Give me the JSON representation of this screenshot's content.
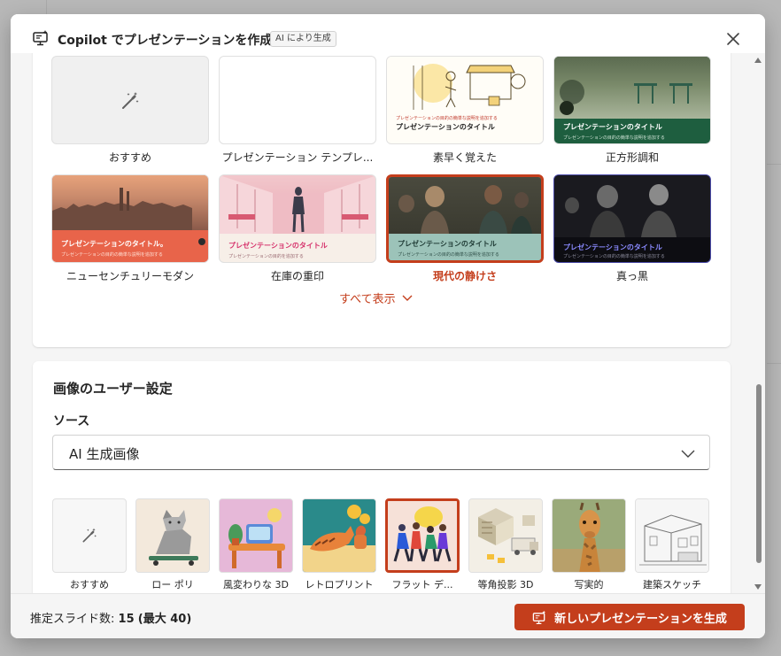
{
  "dialog": {
    "title": "Copilot でプレゼンテーションを作成",
    "ai_badge": "AI により生成"
  },
  "themes": {
    "items": [
      {
        "label": "おすすめ",
        "caption": "",
        "subcaption": ""
      },
      {
        "label": "プレゼンテーション テンプレ...",
        "caption": "",
        "subcaption": ""
      },
      {
        "label": "素早く覚えた",
        "caption": "プレゼンテーションのタイトル",
        "subcaption": "プレゼンテーションの目的の簡単な説明を追加する"
      },
      {
        "label": "正方形調和",
        "caption": "プレゼンテーションのタイトル",
        "subcaption": "プレゼンテーションの目的の簡単な説明を追加する"
      },
      {
        "label": "ニューセンチュリーモダン",
        "caption": "プレゼンテーションのタイトル。",
        "subcaption": "プレゼンテーションの目的の簡単な説明を追加する"
      },
      {
        "label": "在庫の重印",
        "caption": "プレゼンテーションのタイトル",
        "subcaption": "プレゼンテーションの目的を追加する"
      },
      {
        "label": "現代の静けさ",
        "caption": "プレゼンテーションのタイトル",
        "subcaption": "プレゼンテーションの目的の簡単な説明を追加する"
      },
      {
        "label": "真っ黒",
        "caption": "プレゼンテーションのタイトル",
        "subcaption": "プレゼンテーションの目的の簡単な説明を追加する"
      }
    ],
    "selected_index": 6,
    "show_all": "すべて表示"
  },
  "image_settings": {
    "title": "画像のユーザー設定",
    "source_label": "ソース",
    "source_value": "AI 生成画像",
    "styles": [
      {
        "label": "おすすめ"
      },
      {
        "label": "ロー ポリ"
      },
      {
        "label": "風変わりな 3D"
      },
      {
        "label": "レトロプリント"
      },
      {
        "label": "フラット デ..."
      },
      {
        "label": "等角投影 3D"
      },
      {
        "label": "写実的"
      },
      {
        "label": "建築スケッチ"
      }
    ],
    "selected_index": 4
  },
  "footer": {
    "slide_count_label": "推定スライド数:",
    "slide_count": "15",
    "max_label": "(最大 40)",
    "generate_label": "新しいプレゼンテーションを生成"
  },
  "colors": {
    "accent": "#c43e1c",
    "dialog_bg": "#f5f5f5",
    "card_bg": "#ffffff"
  }
}
